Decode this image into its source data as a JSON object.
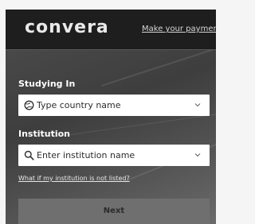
{
  "header": {
    "logo_text": "convera",
    "link_text": "Make your paymen"
  },
  "form": {
    "studying_in": {
      "label": "Studying In",
      "placeholder": "Type country name",
      "icon": "globe-icon"
    },
    "institution": {
      "label": "Institution",
      "placeholder": "Enter institution name",
      "icon": "search-icon"
    },
    "help_link": "What if my institution is not listed?",
    "next_button": "Next"
  }
}
